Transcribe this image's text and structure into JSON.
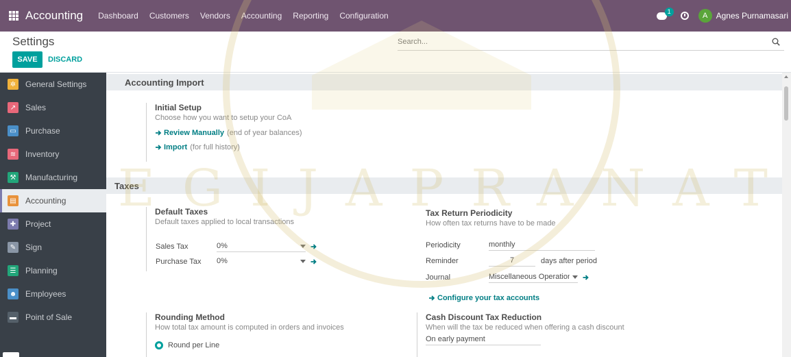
{
  "navbar": {
    "brand": "Accounting",
    "menu": [
      "Dashboard",
      "Customers",
      "Vendors",
      "Accounting",
      "Reporting",
      "Configuration"
    ],
    "chat_badge": "1",
    "avatar_initial": "A",
    "user_name": "Agnes Purnamasari"
  },
  "control_panel": {
    "title": "Settings",
    "save_label": "SAVE",
    "discard_label": "DISCARD",
    "search_placeholder": "Search..."
  },
  "sidebar": {
    "items": [
      {
        "label": "General Settings",
        "icon": "gear-icon",
        "color": "#f0b13b"
      },
      {
        "label": "Sales",
        "icon": "chart-icon",
        "color": "#e8687a"
      },
      {
        "label": "Purchase",
        "icon": "card-icon",
        "color": "#4a8fc8"
      },
      {
        "label": "Inventory",
        "icon": "boxes-icon",
        "color": "#e8687a"
      },
      {
        "label": "Manufacturing",
        "icon": "wrench-icon",
        "color": "#22a67a"
      },
      {
        "label": "Accounting",
        "icon": "document-icon",
        "color": "#e8923b",
        "active": true
      },
      {
        "label": "Project",
        "icon": "puzzle-icon",
        "color": "#7c7bad"
      },
      {
        "label": "Sign",
        "icon": "pen-icon",
        "color": "#8a96a6"
      },
      {
        "label": "Planning",
        "icon": "list-icon",
        "color": "#22a67a"
      },
      {
        "label": "Employees",
        "icon": "people-icon",
        "color": "#4a8fc8"
      },
      {
        "label": "Point of Sale",
        "icon": "register-icon",
        "color": "#55606a"
      }
    ]
  },
  "accounting_import": {
    "header": "Accounting Import",
    "title": "Initial Setup",
    "desc": "Choose how you want to setup your CoA",
    "review_link": "Review Manually",
    "review_note": "(end of year balances)",
    "import_link": "Import",
    "import_note": "(for full history)"
  },
  "taxes": {
    "header": "Taxes",
    "default_taxes": {
      "title": "Default Taxes",
      "desc": "Default taxes applied to local transactions",
      "sales_label": "Sales Tax",
      "sales_value": "0%",
      "purchase_label": "Purchase Tax",
      "purchase_value": "0%"
    },
    "tax_return": {
      "title": "Tax Return Periodicity",
      "desc": "How often tax returns have to be made",
      "periodicity_label": "Periodicity",
      "periodicity_value": "monthly",
      "reminder_label": "Reminder",
      "reminder_value": "7",
      "reminder_suffix": "days after period",
      "journal_label": "Journal",
      "journal_value": "Miscellaneous Operations",
      "configure_link": "Configure your tax accounts"
    },
    "rounding": {
      "title": "Rounding Method",
      "desc": "How total tax amount is computed in orders and invoices",
      "option": "Round per Line"
    },
    "cash_discount": {
      "title": "Cash Discount Tax Reduction",
      "desc": "When will the tax be reduced when offering a cash discount",
      "value": "On early payment"
    }
  },
  "watermark_text": "SOEGIJAPRANATA",
  "colors": {
    "navbar": "#6f5470",
    "primary": "#00a09d",
    "link": "#017e84",
    "sidebar": "#394048"
  }
}
